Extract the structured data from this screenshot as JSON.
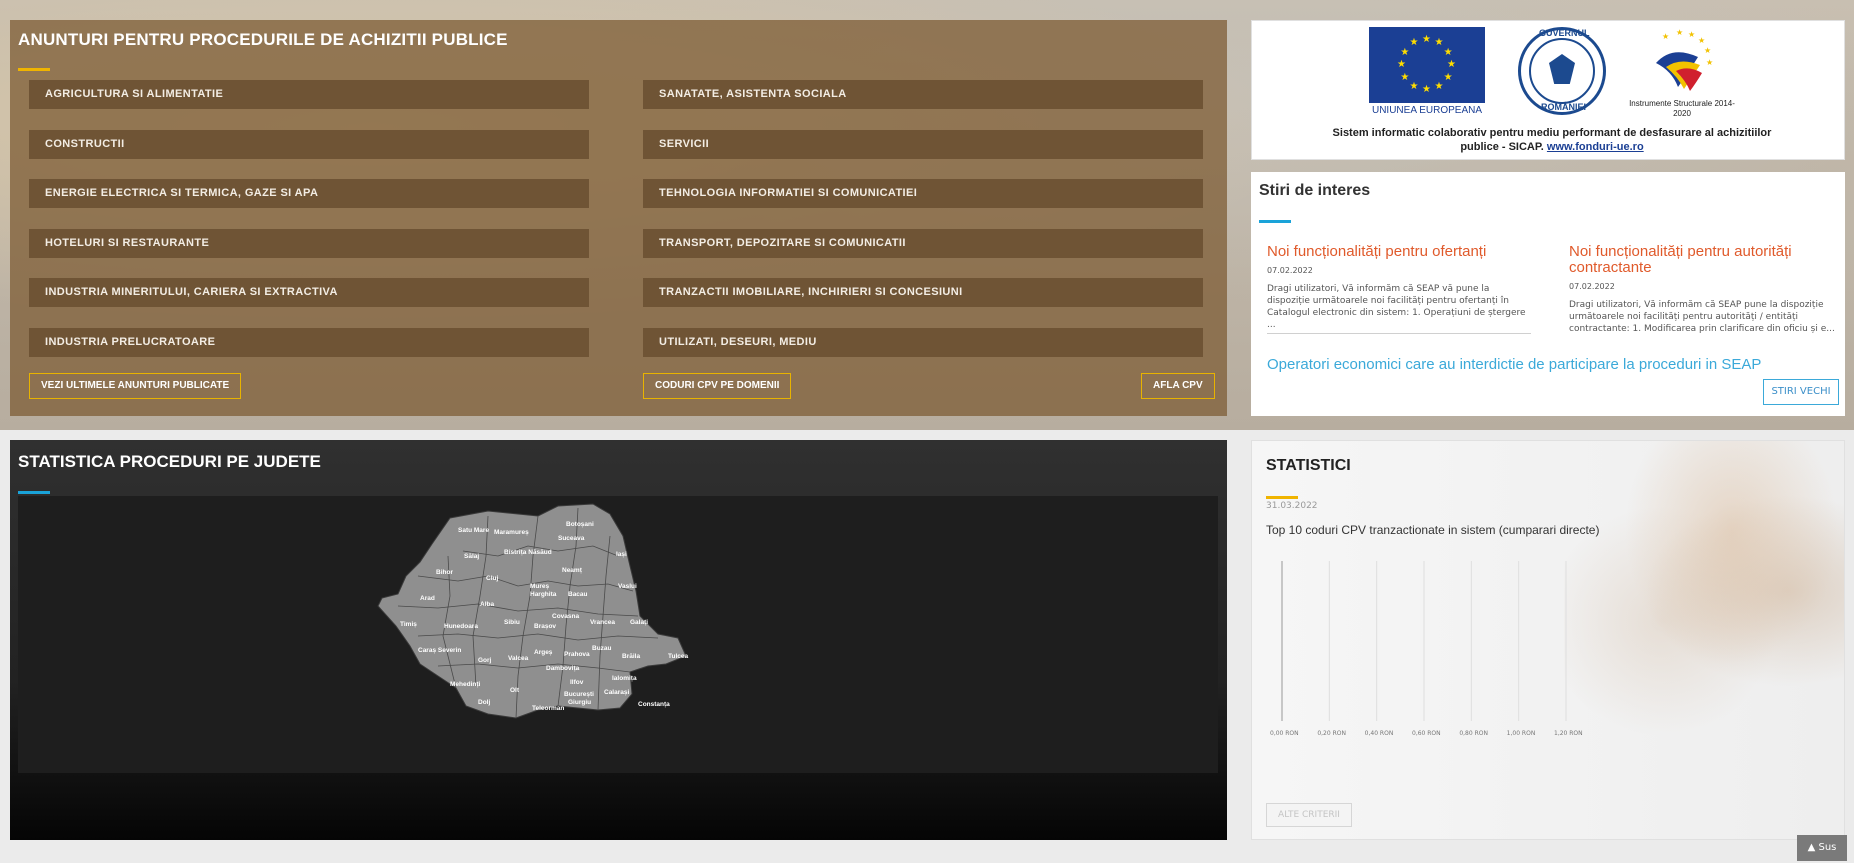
{
  "colors": {
    "accent_yellow": "#f0b400",
    "accent_blue": "#1aa3d9",
    "news_orange": "#e05a2b",
    "eu_blue": "#1b3f94"
  },
  "announcements": {
    "title": "ANUNTURI PENTRU PROCEDURILE DE ACHIZITII PUBLICE",
    "categories_left": [
      "AGRICULTURA SI ALIMENTATIE",
      "CONSTRUCTII",
      "ENERGIE ELECTRICA SI TERMICA, GAZE SI APA",
      "HOTELURI SI RESTAURANTE",
      "INDUSTRIA MINERITULUI, CARIERA SI EXTRACTIVA",
      "INDUSTRIA PRELUCRATOARE"
    ],
    "categories_right": [
      "SANATATE, ASISTENTA SOCIALA",
      "SERVICII",
      "TEHNOLOGIA INFORMATIEI SI COMUNICATIEI",
      "TRANSPORT, DEPOZITARE SI COMUNICATII",
      "TRANZACTII IMOBILIARE, INCHIRIERI SI CONCESIUNI",
      "UTILIZATI, DESEURI, MEDIU"
    ],
    "buttons": {
      "latest": "VEZI ULTIMELE ANUNTURI PUBLICATE",
      "cpv_domains": "CODURI CPV PE DOMENII",
      "find_cpv": "AFLA CPV"
    }
  },
  "eu_panel": {
    "eu_label": "UNIUNEA EUROPEANA",
    "gov_text_top": "GUVERNUL",
    "gov_text_bottom": "ROMÂNIEI",
    "is_label": "Instrumente Structurale 2014-2020",
    "sicap_text": "Sistem informatic colaborativ pentru mediu performant de desfasurare al achizitiilor publice - SICAP.",
    "sicap_link": "www.fonduri-ue.ro"
  },
  "news": {
    "title": "Stiri de interes",
    "items": [
      {
        "heading": "Noi funcționalități pentru ofertanți",
        "date": "07.02.2022",
        "text": "Dragi utilizatori, Vă informăm că SEAP vă pune la dispoziție următoarele noi facilități pentru ofertanți în Catalogul electronic din sistem: 1. Operațiuni de ștergere ..."
      },
      {
        "heading": "Noi funcționalități pentru autorități contractante",
        "date": "07.02.2022",
        "text": "Dragi utilizatori, Vă informăm că SEAP pune la dispoziție următoarele noi facilități pentru autorități / entități contractante: 1. Modificarea prin clarificare din oficiu și e..."
      }
    ],
    "operators_link": "Operatori economici care au interdictie de participare la proceduri in SEAP",
    "old_news_button": "STIRI VECHI"
  },
  "map_panel": {
    "title": "STATISTICA PROCEDURI PE JUDETE",
    "counties": [
      "Satu Mare",
      "Maramureș",
      "Botoșani",
      "Suceava",
      "Sălaj",
      "Bistrița Năsăud",
      "Iași",
      "Bihor",
      "Cluj",
      "Neamț",
      "Mureș",
      "Vaslui",
      "Arad",
      "Harghita",
      "Bacau",
      "Alba",
      "Timiș",
      "Sibiu",
      "Covasna",
      "Hunedoara",
      "Brașov",
      "Vrancea",
      "Galați",
      "Buzau",
      "Caraș Severin",
      "Gorj",
      "Valcea",
      "Argeș",
      "Prahova",
      "Brăila",
      "Tulcea",
      "Dambovița",
      "Ialomița",
      "Mehedinți",
      "Olt",
      "Ilfov",
      "București",
      "Calarași",
      "Constanța",
      "Dolj",
      "Teleorman",
      "Giurgiu"
    ]
  },
  "stats_panel": {
    "title": "STATISTICI",
    "date": "31.03.2022",
    "subtitle": "Top 10 coduri CPV tranzactionate in sistem (cumparari directe)",
    "alte_criterii": "ALTE CRITERII"
  },
  "chart_data": {
    "type": "bar",
    "title": "Top 10 coduri CPV tranzactionate in sistem (cumparari directe)",
    "categories": [],
    "values": [],
    "x_tick_labels": [
      "0,00 RON",
      "0,20 RON",
      "0,40 RON",
      "0,60 RON",
      "0,80 RON",
      "1,00 RON",
      "1,20 RON"
    ],
    "xlim": [
      0,
      1.2
    ],
    "orientation": "horizontal",
    "grid": true
  },
  "back_to_top": "Sus"
}
